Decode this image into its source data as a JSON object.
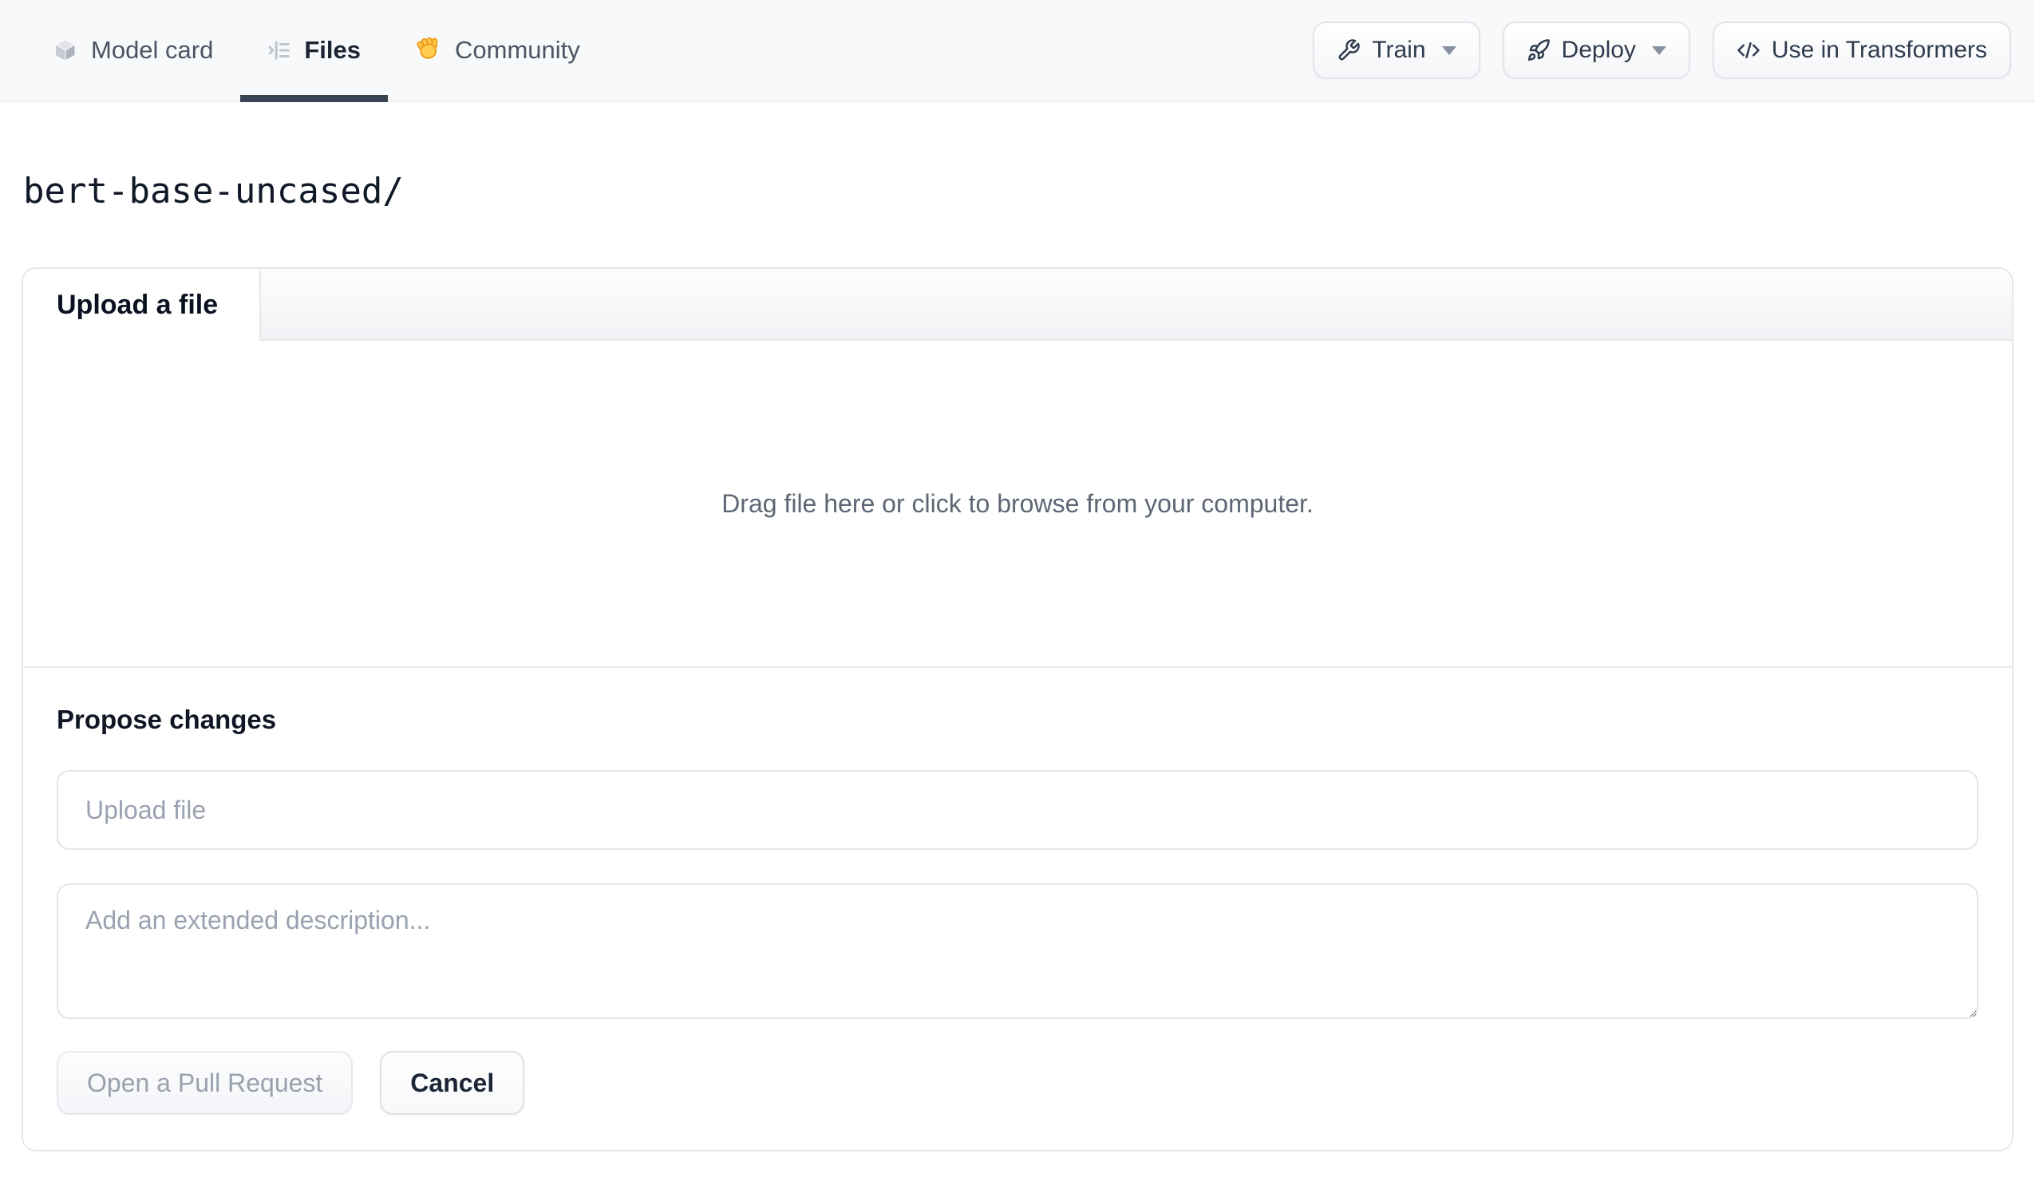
{
  "header": {
    "tabs": [
      {
        "label": "Model card",
        "icon": "cube-icon",
        "active": false
      },
      {
        "label": "Files",
        "icon": "file-tree-icon",
        "active": true
      },
      {
        "label": "Community",
        "icon": "waving-hand-icon",
        "active": false
      }
    ],
    "actions": {
      "train": {
        "label": "Train",
        "icon": "wrench-icon",
        "has_dropdown": true
      },
      "deploy": {
        "label": "Deploy",
        "icon": "rocket-icon",
        "has_dropdown": true
      },
      "use_in_transformers": {
        "label": "Use in Transformers",
        "icon": "code-icon",
        "has_dropdown": false
      }
    }
  },
  "breadcrumb": {
    "path": "bert-base-uncased/"
  },
  "upload_card": {
    "active_tab": "Upload a file",
    "dropzone_text": "Drag file here or click to browse from your computer.",
    "propose": {
      "heading": "Propose changes",
      "file_input_placeholder": "Upload file",
      "file_input_value": "",
      "description_placeholder": "Add an extended description...",
      "description_value": "",
      "submit_label": "Open a Pull Request",
      "cancel_label": "Cancel"
    }
  },
  "colors": {
    "header_bg": "#f8f9fb",
    "active_tab_underline": "#394452",
    "border": "#e5e7eb",
    "muted_text": "#5d6674",
    "placeholder_text": "#9aa2b1",
    "hand_fill": "#ffcc4d",
    "hand_stroke": "#f19a1a"
  }
}
